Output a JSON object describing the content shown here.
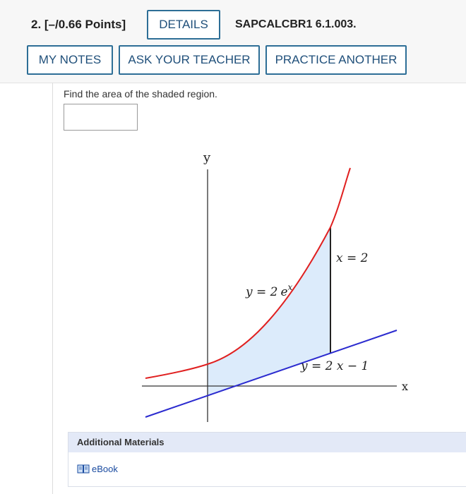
{
  "question": {
    "number_points": "2.  [–/0.66 Points]",
    "details_label": "DETAILS",
    "question_id": "SAPCALCBR1 6.1.003.",
    "my_notes_label": "MY NOTES",
    "ask_teacher_label": "ASK YOUR TEACHER",
    "practice_another_label": "PRACTICE ANOTHER"
  },
  "body": {
    "prompt": "Find the area of the shaded region.",
    "answer_value": ""
  },
  "graph": {
    "y_axis_label": "y",
    "x_axis_label": "x",
    "curve_label_lhs": "y = 2",
    "curve_label_base": "e",
    "curve_label_exp": "x",
    "vertical_line_label": "x = 2",
    "line_label": "y = 2 x − 1",
    "colors": {
      "curve": "#e02020",
      "line": "#2b2bcf",
      "shade": "#dcebfb",
      "axis": "#333333"
    }
  },
  "additional": {
    "header": "Additional Materials",
    "ebook_label": "eBook",
    "ebook_icon": "book-icon"
  }
}
